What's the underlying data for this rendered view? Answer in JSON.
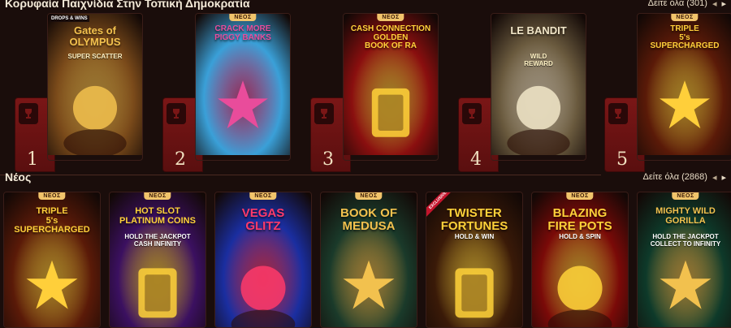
{
  "top_section": {
    "title": "Κορυφαία Παιχνίδια Στην Τοπική Δημοκρατία",
    "see_all": "Δείτε όλα (301)"
  },
  "new_section": {
    "title": "Νέος",
    "see_all": "Δείτε όλα (2868)"
  },
  "new_badge": "ΝΕΟΣ",
  "exclusive_badge": "EXCLUSIVE",
  "top_games": [
    {
      "rank": "1",
      "title": "Gates of\nOLYMPUS",
      "subtitle": "SUPER SCATTER",
      "logo": "DROPS & WINS",
      "is_new": false,
      "bg": "#7a4a1a",
      "accent": "#f2c14e"
    },
    {
      "rank": "2",
      "title": "CRACK MORE\nPIGGY BANKS",
      "subtitle": "",
      "logo": "",
      "is_new": true,
      "bg": "#3aa0d8",
      "accent": "#e94c9b"
    },
    {
      "rank": "3",
      "title": "CASH CONNECTION\nGOLDEN\nBOOK OF RA",
      "subtitle": "",
      "logo": "",
      "is_new": true,
      "bg": "#8a0f0f",
      "accent": "#ffd23a"
    },
    {
      "rank": "4",
      "title": "LE BANDIT",
      "subtitle": "WILD\nREWARD",
      "logo": "",
      "is_new": false,
      "bg": "#6a5a3e",
      "accent": "#f1e6c8"
    },
    {
      "rank": "5",
      "title": "TRIPLE\n5's\nSUPERCHARGED",
      "subtitle": "",
      "logo": "",
      "is_new": true,
      "bg": "#5a1a08",
      "accent": "#ffcf3a"
    }
  ],
  "new_games": [
    {
      "title": "TRIPLE\n5's\nSUPERCHARGED",
      "subtitle": "",
      "is_new": true,
      "exclusive": false,
      "bg": "#5a1a08",
      "accent": "#ffcf3a"
    },
    {
      "title": "HOT SLOT\nPLATINUM COINS",
      "subtitle": "HOLD THE JACKPOT\nCASH INFINITY",
      "is_new": true,
      "exclusive": false,
      "bg": "#3b1060",
      "accent": "#ffd23a"
    },
    {
      "title": "VEGAS\nGLITZ",
      "subtitle": "",
      "is_new": true,
      "exclusive": false,
      "bg": "#1a2ea0",
      "accent": "#ff3a6a"
    },
    {
      "title": "BOOK OF\nMEDUSA",
      "subtitle": "",
      "is_new": true,
      "exclusive": false,
      "bg": "#1a3a2a",
      "accent": "#f2c14e"
    },
    {
      "title": "TWISTER\nFORTUNES",
      "subtitle": "HOLD & WIN",
      "is_new": false,
      "exclusive": true,
      "bg": "#3a1a08",
      "accent": "#ffd23a"
    },
    {
      "title": "BLAZING\nFIRE POTS",
      "subtitle": "HOLD & SPIN",
      "is_new": true,
      "exclusive": false,
      "bg": "#7a0a08",
      "accent": "#ffd23a"
    },
    {
      "title": "MIGHTY WILD\nGORILLA",
      "subtitle": "HOLD THE JACKPOT\nCOLLECT TO INFINITY",
      "is_new": true,
      "exclusive": false,
      "bg": "#0e3a2a",
      "accent": "#f2c14e"
    }
  ]
}
